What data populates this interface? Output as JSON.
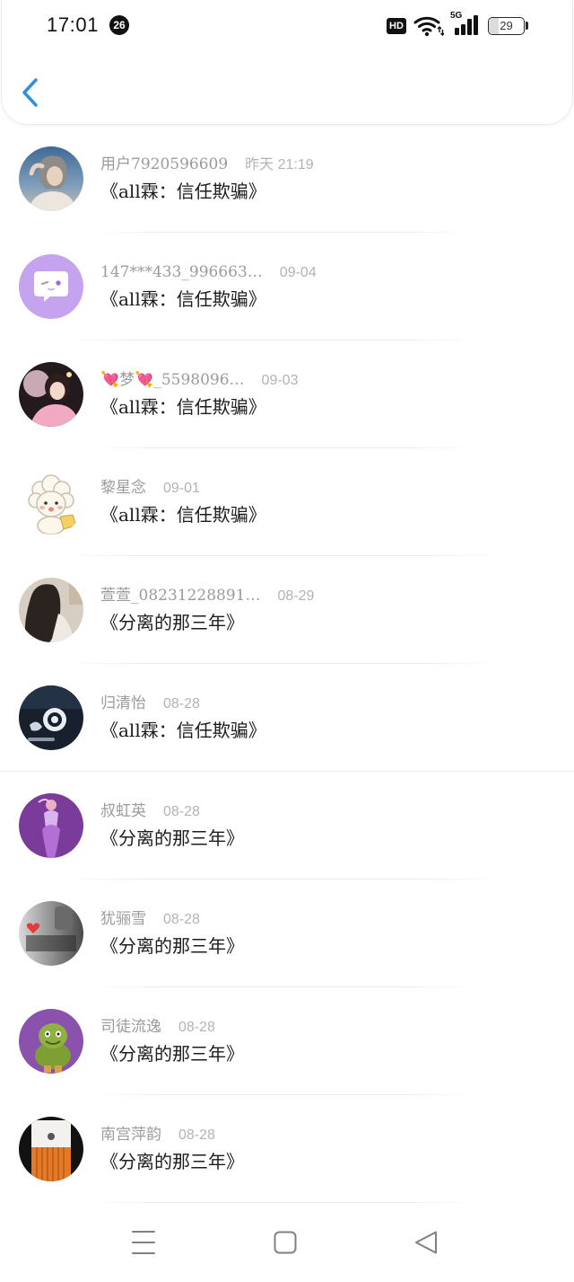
{
  "status_bar": {
    "time": "17:01",
    "notification_badge": "26",
    "hd_label": "HD",
    "network_type": "5G",
    "battery_level": "29",
    "icons": [
      "hd-icon",
      "wifi-icon",
      "signal-icon",
      "battery-icon"
    ]
  },
  "header": {
    "back_icon": "chevron-left-icon"
  },
  "messages": [
    {
      "name": "用户7920596609",
      "date": "昨天 21:19",
      "title": "《all霖：信任欺骗》"
    },
    {
      "name": "147***433_996663…",
      "date": "09-04",
      "title": "《all霖：信任欺骗》"
    },
    {
      "name": "💘梦💘_5598096…",
      "date": "09-03",
      "title": "《all霖：信任欺骗》"
    },
    {
      "name": "黎星念",
      "date": "09-01",
      "title": "《all霖：信任欺骗》"
    },
    {
      "name": "萱萱_08231228891…",
      "date": "08-29",
      "title": "《分离的那三年》"
    },
    {
      "name": "归清怡",
      "date": "08-28",
      "title": "《all霖：信任欺骗》"
    },
    {
      "name": "叔虹英",
      "date": "08-28",
      "title": "《分离的那三年》"
    },
    {
      "name": "犹骊雪",
      "date": "08-28",
      "title": "《分离的那三年》"
    },
    {
      "name": "司徒流逸",
      "date": "08-28",
      "title": "《分离的那三年》"
    },
    {
      "name": "南宫萍韵",
      "date": "08-28",
      "title": "《分离的那三年》"
    }
  ],
  "nav_bar": {
    "icons": [
      "menu-icon",
      "home-square-icon",
      "back-triangle-icon"
    ]
  },
  "colors": {
    "accent": "#2f8fe8",
    "title_text": "#1c1c1c",
    "name_text": "#9b9b9b",
    "date_text": "#b3b3b3",
    "nav_icon": "#808080"
  }
}
